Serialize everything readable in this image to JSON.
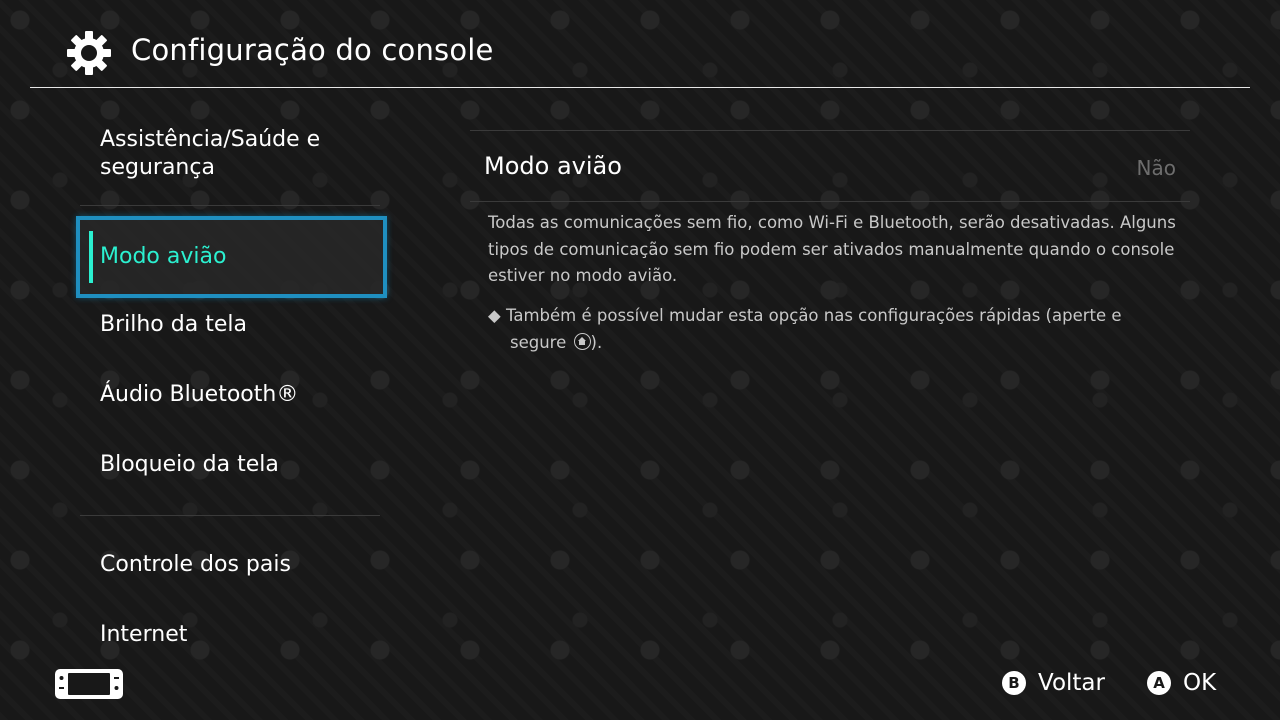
{
  "header": {
    "title": "Configuração do console",
    "icon": "gear-icon"
  },
  "sidebar": {
    "items": [
      {
        "label": "Assistência/Saúde e segurança"
      },
      {
        "label": "Modo avião",
        "selected": true
      },
      {
        "label": "Brilho da tela"
      },
      {
        "label": "Áudio Bluetooth®"
      },
      {
        "label": "Bloqueio da tela"
      },
      {
        "label": "Controle dos pais"
      },
      {
        "label": "Internet"
      }
    ],
    "selected_color": "#2bf0d0",
    "selection_border_color": "#1f8fc0"
  },
  "content": {
    "option": {
      "label": "Modo avião",
      "value": "Não"
    },
    "description": "Todas as comunicações sem fio, como Wi-Fi e Bluetooth, serão desativadas. Alguns tipos de comunicação sem fio podem ser ativados manualmente quando o console estiver no modo avião.",
    "note_bullet": "◆",
    "note_line1": "Também é possível mudar esta opção nas configurações rápidas (aperte e",
    "note_line2": "segure",
    "note_end": ").",
    "note_icon": "home-button-icon"
  },
  "footer": {
    "console_icon": "handheld-console-icon",
    "back": {
      "button": "B",
      "label": "Voltar"
    },
    "ok": {
      "button": "A",
      "label": "OK"
    }
  }
}
